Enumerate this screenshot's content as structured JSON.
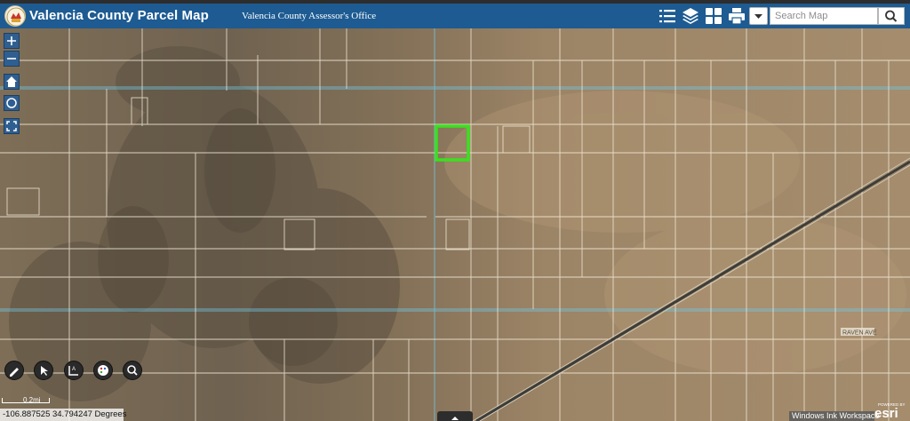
{
  "header": {
    "title": "Valencia County Parcel Map",
    "subtitle": "Valencia County Assessor's Office",
    "icons": [
      "legend-list-icon",
      "layers-icon",
      "basemap-gallery-icon",
      "print-icon"
    ]
  },
  "search": {
    "placeholder": "Search Map",
    "value": ""
  },
  "map_tools": [
    "zoom-in-icon",
    "zoom-out-icon",
    "home-icon",
    "locate-icon",
    "fullscreen-icon"
  ],
  "sketch_tools": [
    "draw-tool-icon",
    "select-tool-icon",
    "measure-tool-icon",
    "color-palette-icon",
    "identify-tool-icon"
  ],
  "map": {
    "scale_label": "0.2mi",
    "coordinates": "-106.887525 34.794247 Degrees",
    "road_labels": [
      "RAVEN AVE"
    ],
    "attribution": "Windows Ink Workspace",
    "esri_powered": "POWERED BY",
    "esri_brand": "esri",
    "selection_color": "#39e11e",
    "parcel_line_color": "#f3ead8",
    "section_line_color": "#6fc7e6"
  },
  "colors": {
    "header_bg": "#1d5b92",
    "header_text": "#ffffff"
  }
}
